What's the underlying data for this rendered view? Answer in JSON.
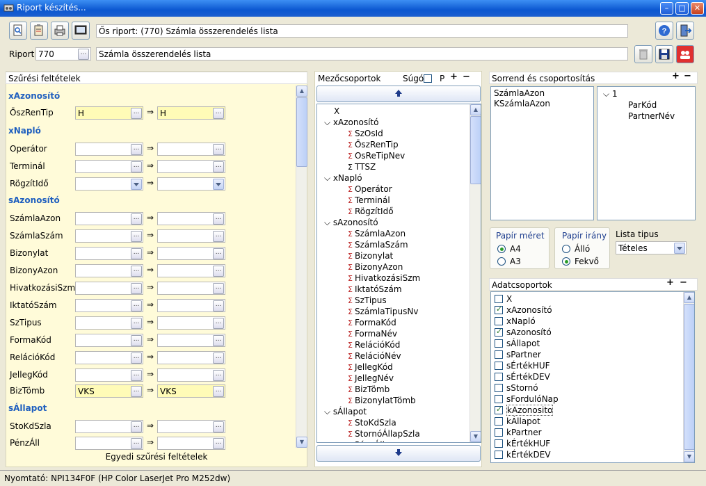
{
  "window": {
    "title": "Riport készítés..."
  },
  "toolbar": {
    "os_riport_text": "Ős riport: (770)  Számla összerendelés lista"
  },
  "riport": {
    "label": "Riport",
    "id": "770",
    "name": "Számla összerendelés lista"
  },
  "filters": {
    "header": "Szűrési feltételek",
    "footer": "Egyedi szűrési feltételek",
    "groups": [
      {
        "name": "xAzonosító"
      },
      {
        "name": "xNapló"
      },
      {
        "name": "sAzonosító"
      },
      {
        "name": "sÁllapot"
      }
    ],
    "rows": [
      {
        "label": "ÖszRenTip",
        "from": "H",
        "to": "H"
      },
      {
        "label": "Operátor",
        "from": "",
        "to": ""
      },
      {
        "label": "Terminál",
        "from": "",
        "to": ""
      },
      {
        "label": "RögzítIdő",
        "from": "",
        "to": ""
      },
      {
        "label": "SzámlaAzon",
        "from": "",
        "to": ""
      },
      {
        "label": "SzámlaSzám",
        "from": "",
        "to": ""
      },
      {
        "label": "Bizonylat",
        "from": "",
        "to": ""
      },
      {
        "label": "BizonyAzon",
        "from": "",
        "to": ""
      },
      {
        "label": "HivatkozásiSzm",
        "from": "",
        "to": ""
      },
      {
        "label": "IktatóSzám",
        "from": "",
        "to": ""
      },
      {
        "label": "SzTipus",
        "from": "",
        "to": ""
      },
      {
        "label": "FormaKód",
        "from": "",
        "to": ""
      },
      {
        "label": "RelációKód",
        "from": "",
        "to": ""
      },
      {
        "label": "JellegKód",
        "from": "",
        "to": ""
      },
      {
        "label": "BizTömb",
        "from": "VKS",
        "to": "VKS"
      },
      {
        "label": "StoKdSzla",
        "from": "",
        "to": ""
      },
      {
        "label": "PénzÁll",
        "from": "",
        "to": ""
      }
    ],
    "arrow": "⇒"
  },
  "fieldgroups": {
    "header": "Mezőcsoportok",
    "sugo": "Súgó",
    "p": "P",
    "nodes": [
      {
        "text": "X"
      },
      {
        "text": "xAzonosító"
      },
      {
        "text": "SzOsId"
      },
      {
        "text": "ÖszRenTip"
      },
      {
        "text": "OsReTipNev"
      },
      {
        "text": "TTSZ"
      },
      {
        "text": "xNapló"
      },
      {
        "text": "Operátor"
      },
      {
        "text": "Terminál"
      },
      {
        "text": "RögzítIdő"
      },
      {
        "text": "sAzonosító"
      },
      {
        "text": "SzámlaAzon"
      },
      {
        "text": "SzámlaSzám"
      },
      {
        "text": "Bizonylat"
      },
      {
        "text": "BizonyAzon"
      },
      {
        "text": "HivatkozásiSzm"
      },
      {
        "text": "IktatóSzám"
      },
      {
        "text": "SzTipus"
      },
      {
        "text": "SzámlaTipusNv"
      },
      {
        "text": "FormaKód"
      },
      {
        "text": "FormaNév"
      },
      {
        "text": "RelációKód"
      },
      {
        "text": "RelációNév"
      },
      {
        "text": "JellegKód"
      },
      {
        "text": "JellegNév"
      },
      {
        "text": "BizTömb"
      },
      {
        "text": "BizonylatTömb"
      },
      {
        "text": "sÁllapot"
      },
      {
        "text": "StoKdSzla"
      },
      {
        "text": "StornóÁllapSzla"
      },
      {
        "text": "PénzÁll"
      }
    ]
  },
  "sort": {
    "header": "Sorrend és csoportosítás",
    "left": [
      "SzámlaAzon",
      "KSzámlaAzon"
    ],
    "tree_root": "1",
    "tree_children": [
      "ParKód",
      "PartnerNév"
    ]
  },
  "paper": {
    "size_label": "Papír méret",
    "sizes": [
      "A4",
      "A3"
    ],
    "orient_label": "Papír irány",
    "orients": [
      "Álló",
      "Fekvő"
    ],
    "list_type_label": "Lista tipus",
    "list_type_value": "Tételes"
  },
  "datagroups": {
    "header": "Adatcsoportok",
    "items": [
      {
        "text": "X",
        "checked": false
      },
      {
        "text": "xAzonosító",
        "checked": true
      },
      {
        "text": "xNapló",
        "checked": false
      },
      {
        "text": "sAzonosító",
        "checked": true
      },
      {
        "text": "sÁllapot",
        "checked": false
      },
      {
        "text": "sPartner",
        "checked": false
      },
      {
        "text": "sÉrtékHUF",
        "checked": false
      },
      {
        "text": "sÉrtékDEV",
        "checked": false
      },
      {
        "text": "sStornó",
        "checked": false
      },
      {
        "text": "sFordulóNap",
        "checked": false
      },
      {
        "text": "kAzonosito",
        "checked": true
      },
      {
        "text": "kÁllapot",
        "checked": false
      },
      {
        "text": "kPartner",
        "checked": false
      },
      {
        "text": "kÉrtékHUF",
        "checked": false
      },
      {
        "text": "kÉrtékDEV",
        "checked": false
      }
    ]
  },
  "status": {
    "printer": "Nyomtató: NPI134F0F (HP Color LaserJet Pro M252dw)"
  }
}
